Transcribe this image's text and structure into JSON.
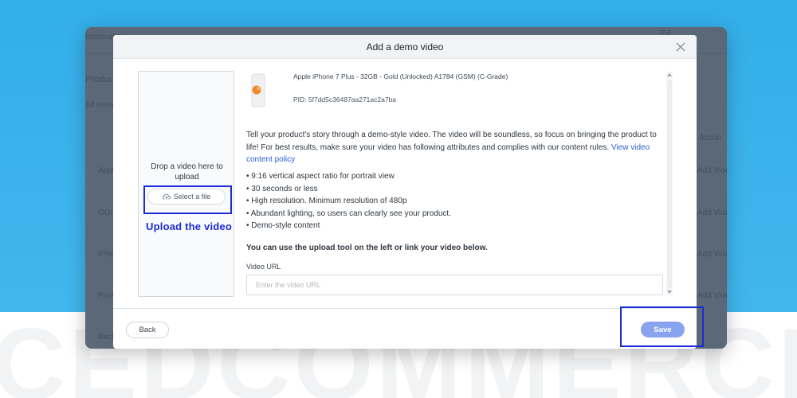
{
  "watermark": "CEDCOMMERCE",
  "background_app": {
    "tab_label": "Information",
    "top_right_label": "Ed",
    "section_label": "Products",
    "filter_label": "All items",
    "column_label": "Action",
    "row_labels": [
      "Apple",
      "OOI",
      "iPhone",
      "Pixel"
    ],
    "action_labels": [
      "Add Video",
      "Add Video",
      "Add Video",
      "Add Video"
    ],
    "bottom_label": "Back"
  },
  "modal": {
    "title": "Add a demo video",
    "upload_panel": {
      "drop_text": "Drop a video here to upload",
      "select_button": "Select a file",
      "annotation": "Upload the video"
    },
    "product": {
      "title": "Apple iPhone 7 Plus - 32GB - Gold (Unlocked) A1784 (GSM) (C-Grade)",
      "pid": "PID: 5f7dd5c36487aa271ac2a7ba"
    },
    "intro": "Tell your product's story through a demo-style video. The video will be soundless, so focus on bringing the product to life! For best results, make sure your video has following attributes and complies with our content rules.",
    "policy_link": "View video content policy",
    "attributes": [
      "• 9:16 vertical aspect ratio for portrait view",
      "• 30 seconds or less",
      "• High resolution. Minimum resolution of 480p",
      "• Abundant lighting, so users can clearly see your product.",
      "• Demo-style content"
    ],
    "upload_note": "You can use the upload tool on the left or link your video below.",
    "url_label": "Video URL",
    "url_placeholder": "Enter the video URL",
    "url_value": "",
    "back_button": "Back",
    "save_button": "Save"
  },
  "colors": {
    "accent_blue": "#1a2bd6",
    "save_button": "#8aa3ee",
    "link": "#2a5fce",
    "backdrop_blue": "#3cb2ea"
  }
}
